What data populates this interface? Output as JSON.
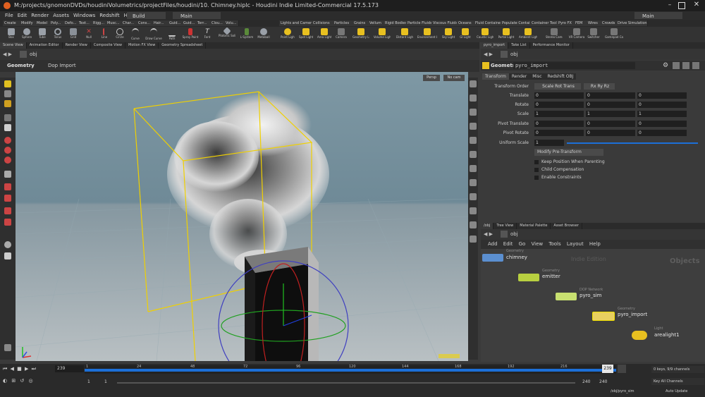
{
  "window": {
    "title": "M:/projects/gnomonDVDs/houdiniVolumetrics/projectFiles/houdini/10. Chimney.hiplc - Houdini Indie Limited-Commercial 17.5.173"
  },
  "menubar": {
    "items": [
      "File",
      "Edit",
      "Render",
      "Assets",
      "Windows",
      "Redshift",
      "Help"
    ],
    "desktop": "Build",
    "main": "Main",
    "right_main": "Main"
  },
  "shelf_tabs_left": [
    "Create",
    "Modify",
    "Model",
    "Poly...",
    "Defo...",
    "Text...",
    "Rigg...",
    "Musc...",
    "Char...",
    "Cons...",
    "Hair...",
    "Guid...",
    "Guid...",
    "Terr...",
    "Clou...",
    "Volu..."
  ],
  "shelf_tabs_right": [
    "Lights and Cameras",
    "Collisions",
    "Particles",
    "Grains",
    "Vellum",
    "Rigid Bodies",
    "Particle Fluids",
    "Viscous Fluids",
    "Oceans",
    "Fluid Containers",
    "Populate Containers",
    "Container Tools",
    "Pyro FX",
    "FEM",
    "Wires",
    "Crowds",
    "Drive Simulation"
  ],
  "shelf_tools_left": [
    "Box",
    "Sphere",
    "Tube",
    "Torus",
    "Grid",
    "Null",
    "Line",
    "Circle",
    "Curve",
    "Draw Curve",
    "Path",
    "Spray Paint",
    "Font",
    "Platonic Solids",
    "L-System",
    "Metaball"
  ],
  "shelf_tools_right": [
    "Point Light",
    "Spot Light",
    "Area Light",
    "Camera",
    "Geometry Light",
    "Volume Light",
    "Distant Light",
    "Environment Light",
    "Sky Light",
    "GI Light",
    "Caustic Light",
    "Portal Light",
    "Ambient Light",
    "Stereo Camera",
    "VR Camera",
    "Switcher",
    "Gamepad Camera"
  ],
  "left_pane_tabs": [
    "Scene View",
    "Animation Editor",
    "Render View",
    "Composite View",
    "Motion FX View",
    "Geometry Spreadsheet"
  ],
  "right_pane_tabs": [
    "pyro_import",
    "Take List",
    "Performance Monitor"
  ],
  "viewport": {
    "path": "obj",
    "context": "Geometry",
    "dop_import": "Dop Import",
    "persp": "Persp",
    "cam": "No cam"
  },
  "params": {
    "path": "obj",
    "node_type": "Geometry",
    "node_name": "pyro_import",
    "tabs": [
      "Transform",
      "Render",
      "Misc",
      "Redshift OBJ"
    ],
    "transform_order_label": "Transform Order",
    "transform_order": "Scale Rot Trans",
    "rotate_order": "Rx Ry Rz",
    "rows": [
      {
        "label": "Translate",
        "values": [
          "0",
          "0",
          "0"
        ]
      },
      {
        "label": "Rotate",
        "values": [
          "0",
          "0",
          "0"
        ]
      },
      {
        "label": "Scale",
        "values": [
          "1",
          "1",
          "1"
        ]
      },
      {
        "label": "Pivot Translate",
        "values": [
          "0",
          "0",
          "0"
        ]
      },
      {
        "label": "Pivot Rotate",
        "values": [
          "0",
          "0",
          "0"
        ]
      }
    ],
    "uniform_scale_label": "Uniform Scale",
    "uniform_scale": "1",
    "modify_button": "Modify Pre-Transform",
    "checkboxes": [
      "Keep Position When Parenting",
      "Child Compensation",
      "Enable Constraints"
    ]
  },
  "network": {
    "tabs": [
      "/obj",
      "Tree View",
      "Material Palette",
      "Asset Browser"
    ],
    "path": "obj",
    "menu": [
      "Add",
      "Edit",
      "Go",
      "View",
      "Tools",
      "Layout",
      "Help"
    ],
    "watermark": "Indie Edition",
    "context_label": "Objects",
    "nodes": [
      {
        "type": "Geometry",
        "name": "chimney"
      },
      {
        "type": "Geometry",
        "name": "emitter"
      },
      {
        "type": "DOP Network",
        "name": "pyro_sim"
      },
      {
        "type": "Geometry",
        "name": "pyro_import"
      },
      {
        "type": "Light",
        "name": "arealight1"
      }
    ]
  },
  "timeline": {
    "current_frame": "239",
    "ticks": [
      "1",
      "24",
      "48",
      "72",
      "96",
      "120",
      "144",
      "168",
      "192",
      "216"
    ],
    "playhead": "239",
    "range_start": "1",
    "range_start2": "1",
    "range_end": "240",
    "range_end2": "240",
    "keys": "0 keys, 9/9 channels",
    "key_all": "Key All Channels",
    "obj_path": "/obj/pyro_sim",
    "auto_update": "Auto Update"
  },
  "colors": {
    "accent": "#1c6fd8",
    "selection": "#f0d000",
    "bg": "#3a3a3a"
  }
}
